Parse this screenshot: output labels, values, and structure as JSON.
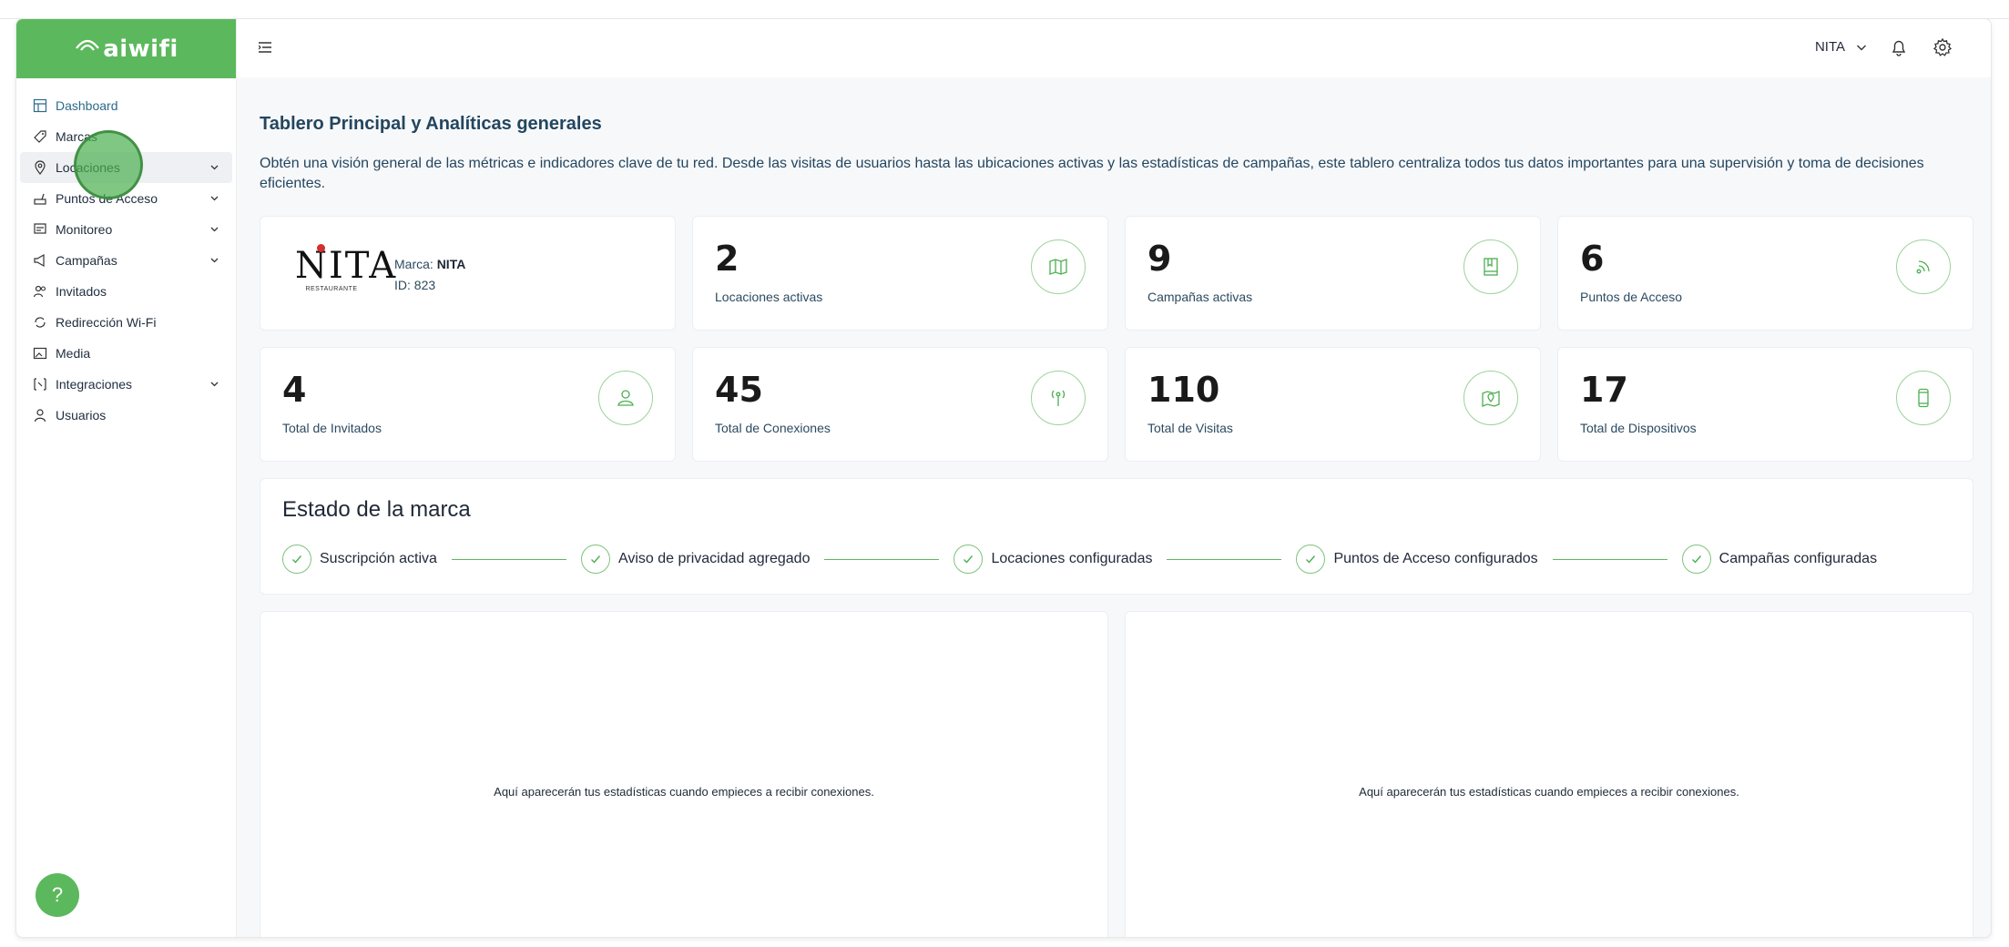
{
  "brand": {
    "logo_text": "aiwifi"
  },
  "sidebar": {
    "items": [
      {
        "label": "Dashboard",
        "icon": "dashboard-icon"
      },
      {
        "label": "Marcas",
        "icon": "tag-icon"
      },
      {
        "label": "Locaciones",
        "icon": "location-pin-icon"
      },
      {
        "label": "Puntos de Acceso",
        "icon": "router-icon"
      },
      {
        "label": "Monitoreo",
        "icon": "monitor-icon"
      },
      {
        "label": "Campañas",
        "icon": "megaphone-icon"
      },
      {
        "label": "Invitados",
        "icon": "users-icon"
      },
      {
        "label": "Redirección Wi-Fi",
        "icon": "redirect-icon"
      },
      {
        "label": "Media",
        "icon": "image-icon"
      },
      {
        "label": "Integraciones",
        "icon": "integrations-icon"
      },
      {
        "label": "Usuarios",
        "icon": "user-icon"
      }
    ],
    "help_label": "?"
  },
  "header": {
    "user": "NITA"
  },
  "main": {
    "title": "Tablero Principal y Analíticas generales",
    "description": "Obtén una visión general de las métricas e indicadores clave de tu red. Desde las visitas de usuarios hasta las ubicaciones activas y las estadísticas de campañas, este tablero centraliza todos tus datos importantes para una supervisión y toma de decisiones eficientes.",
    "brand_card": {
      "logo_name": "NITA",
      "logo_sub": "RESTAURANTE",
      "marca_label": "Marca: ",
      "marca_value": "NITA",
      "id_text": "ID: 823"
    },
    "stats": [
      {
        "value": "2",
        "label": "Locaciones activas",
        "icon": "map-icon"
      },
      {
        "value": "9",
        "label": "Campañas activas",
        "icon": "book-icon"
      },
      {
        "value": "6",
        "label": "Puntos de Acceso",
        "icon": "signal-icon"
      },
      {
        "value": "4",
        "label": "Total de Invitados",
        "icon": "person-icon"
      },
      {
        "value": "45",
        "label": "Total de Conexiones",
        "icon": "antenna-icon"
      },
      {
        "value": "110",
        "label": "Total de Visitas",
        "icon": "map-pin-icon"
      },
      {
        "value": "17",
        "label": "Total de Dispositivos",
        "icon": "phone-icon"
      }
    ],
    "status": {
      "title": "Estado de la marca",
      "steps": [
        "Suscripción activa",
        "Aviso de privacidad agregado",
        "Locaciones configuradas",
        "Puntos de Acceso configurados",
        "Campañas configuradas"
      ]
    },
    "empty_message": "Aquí aparecerán tus estadísticas cuando empieces a recibir conexiones."
  },
  "colors": {
    "accent": "#5cb85c",
    "text_primary": "#23465f"
  }
}
